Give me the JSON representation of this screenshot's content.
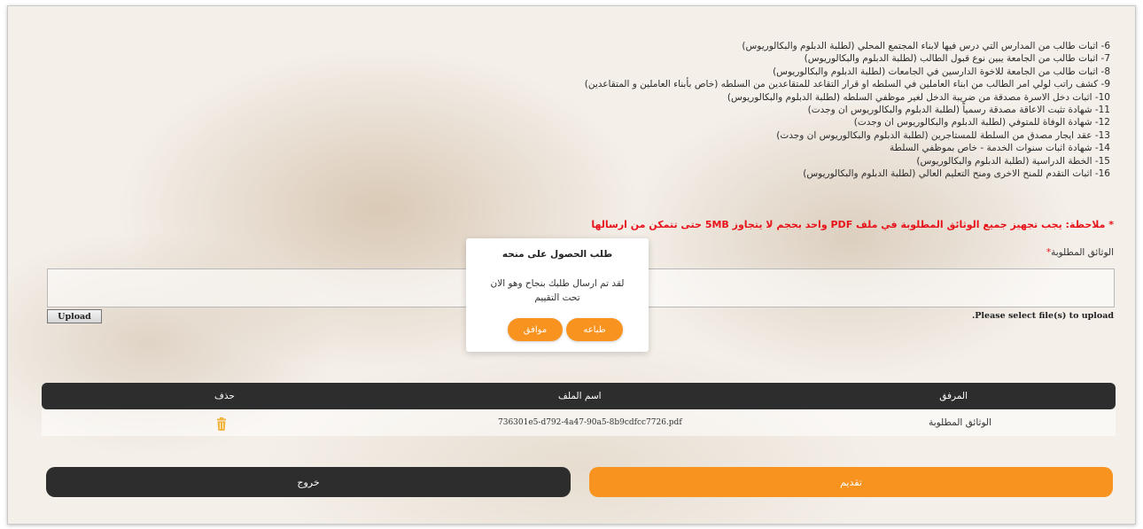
{
  "documents": [
    "6- اثبات طالب من المدارس التي درس فيها لابناء المجتمع المحلي (لطلبة الدبلوم والبكالوريوس)",
    "7- اثبات طالب من الجامعة يبين نوع قبول الطالب (لطلبة الدبلوم والبكالوريوس)",
    "8- اثبات طالب من الجامعة للاخوة الدارسين في الجامعات (لطلبة الدبلوم والبكالوريوس)",
    "9- كشف راتب لولي امر الطالب من ابناء العاملين في السلطه او قرار التقاعد للمتقاعدين من السلطه (خاص بأبناء العاملين و المتقاعدين)",
    "10- اثبات دخل الاسرة مصدقة من ضريبة الدخل لغير موظفي السلطه (لطلبة الدبلوم والبكالوريوس)",
    "11- شهادة تثبت الاعاقة مصدقة رسمياً (لطلبة الدبلوم والبكالوريوس ان وجدت)",
    "12- شهادة الوفاة للمتوفي (لطلبة الدبلوم والبكالوريوس ان وجدت)",
    "13- عقد ايجار مصدق من السلطة للمستاجرين (لطلبة الدبلوم والبكالوريوس ان وجدت)",
    "14- شهادة اثبات سنوات الخدمة - خاص بموظفي السلطة",
    "15- الخطة الدراسية (لطلبة الدبلوم والبكالوريوس)",
    "16- اثبات التقدم للمنح الاخرى ومنح التعليم العالي (لطلبة الدبلوم والبكالوريوس)"
  ],
  "note": "* ملاحظة: يجب تجهيز جميع الوثائق المطلوبة في ملف PDF واحد بحجم لا يتجاوز 5MB حتى تتمكن من ارسالها",
  "upload": {
    "label": "الوثائق المطلوبة",
    "required_mark": "*",
    "button_label": "Upload",
    "hint": ".Please select file(s) to upload"
  },
  "modal": {
    "title": "طلب الحصول على منحه",
    "message": "لقد تم ارسال طلبك بنجاح وهو الان تحت التقييم",
    "print_label": "طباعه",
    "ok_label": "موافق"
  },
  "table": {
    "headers": {
      "attachment": "المرفق",
      "file_name": "اسم الملف",
      "delete": "حذف"
    },
    "rows": [
      {
        "attachment": "الوثائق المطلوبة",
        "file_name": "736301e5-d792-4a47-90a5-8b9cdfcc7726.pdf",
        "delete_icon": "trash-icon"
      }
    ]
  },
  "actions": {
    "submit_label": "تقديم",
    "exit_label": "خروج"
  },
  "colors": {
    "accent": "#f7931e",
    "dark": "#2d2d2d",
    "note": "#e8131a"
  }
}
